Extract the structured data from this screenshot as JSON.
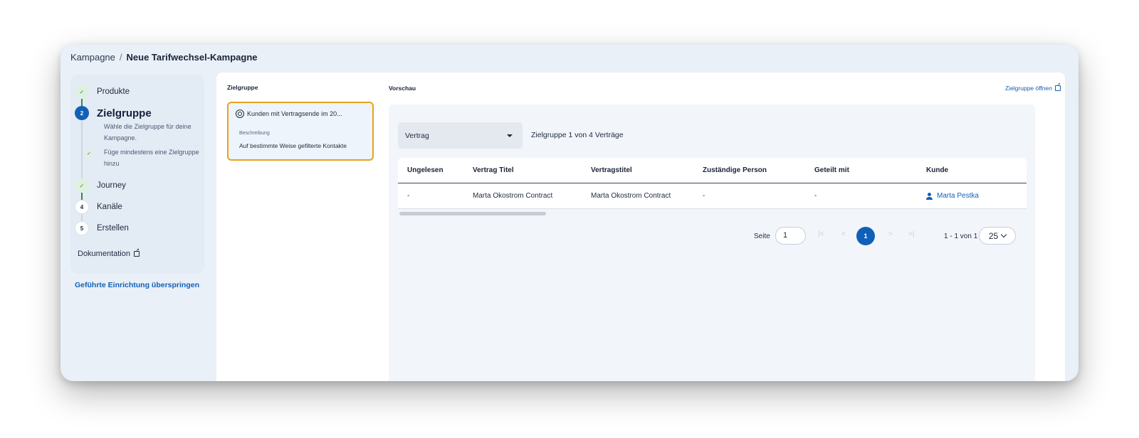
{
  "breadcrumb": {
    "root": "Kampagne",
    "separator": "/",
    "current": "Neue Tarifwechsel-Kampagne"
  },
  "stepper": {
    "steps": [
      {
        "number": "✓",
        "label": "Produkte",
        "state": "done"
      },
      {
        "number": "2",
        "label": "Zielgruppe",
        "state": "active",
        "description": "Wähle die Zielgruppe für deine Kampagne."
      },
      {
        "label": "Journey",
        "number": "✓",
        "state": "done"
      },
      {
        "label": "Kanäle",
        "number": "4",
        "state": "todo"
      },
      {
        "label": "Erstellen",
        "number": "5",
        "state": "todo"
      }
    ],
    "substep": "Füge mindestens eine Zielgruppe hinzu",
    "documentation": "Dokumentation",
    "skip": "Geführte Einrichtung überspringen"
  },
  "zielgruppe": {
    "title": "Zielgruppe",
    "card": {
      "name": "Kunden mit Vertragsende im 20...",
      "description_label": "Beschreibung",
      "description": "Auf bestimmte Weise gefilterte Kontakte"
    }
  },
  "vorschau": {
    "title": "Vorschau",
    "open_link": "Zielgruppe öffnen",
    "select_value": "Vertrag",
    "select_info": "Zielgruppe 1 von 4 Verträge",
    "table": {
      "headers": [
        "Ungelesen",
        "Vertrag Titel",
        "Vertragstitel",
        "Zuständige Person",
        "Geteilt mit",
        "Kunde"
      ],
      "rows": [
        [
          "-",
          "Marta Okostrom Contract",
          "Marta Okostrom Contract",
          "-",
          "-",
          "Marta Pestka"
        ]
      ]
    },
    "pagination": {
      "page_label": "Seite",
      "page_input": "1",
      "current_page": "1",
      "range": "1 - 1 von 1",
      "per_page": "25",
      "first": "|<",
      "prev": "<",
      "next": ">",
      "last": ">|"
    }
  },
  "colors": {
    "accent": "#1160b7",
    "done": "#2f8b3c",
    "highlight": "#e8a21c"
  }
}
